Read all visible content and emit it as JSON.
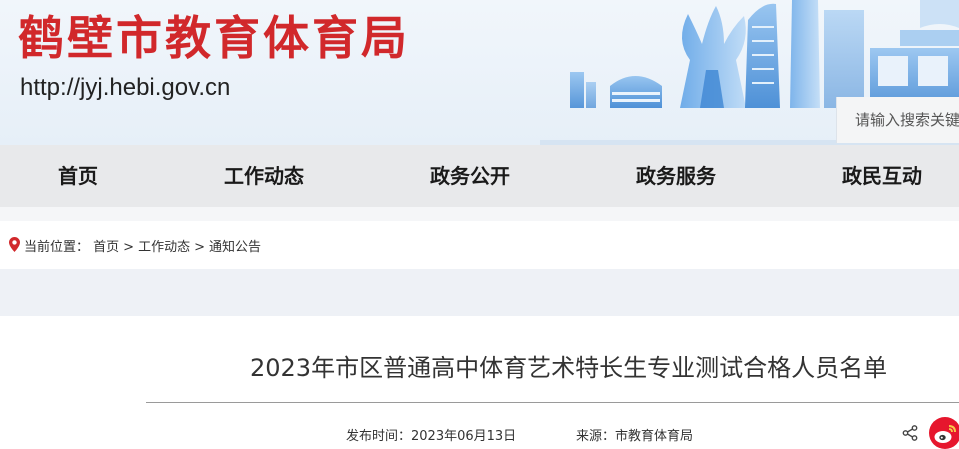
{
  "header": {
    "site_title": "鹤壁市教育体育局",
    "site_url": "http://jyj.hebi.gov.cn"
  },
  "search": {
    "placeholder": "请输入搜索关键"
  },
  "nav": {
    "items": [
      {
        "label": "首页"
      },
      {
        "label": "工作动态"
      },
      {
        "label": "政务公开"
      },
      {
        "label": "政务服务"
      },
      {
        "label": "政民互动"
      }
    ]
  },
  "breadcrumb": {
    "prefix": "当前位置：",
    "items": [
      "首页",
      "工作动态",
      "通知公告"
    ],
    "separator": ">"
  },
  "article": {
    "title": "2023年市区普通高中体育艺术特长生专业测试合格人员名单",
    "date_text": "发布时间：2023年06月13日",
    "source_text": "来源：市教育体育局"
  },
  "colors": {
    "brand_red": "#d1282b",
    "skyline_blue": "#4a90d9",
    "nav_bg": "#e8e9eb",
    "weibo_red": "#e6162d"
  },
  "icons": [
    "location-pin-icon",
    "share-icon",
    "weibo-icon"
  ]
}
